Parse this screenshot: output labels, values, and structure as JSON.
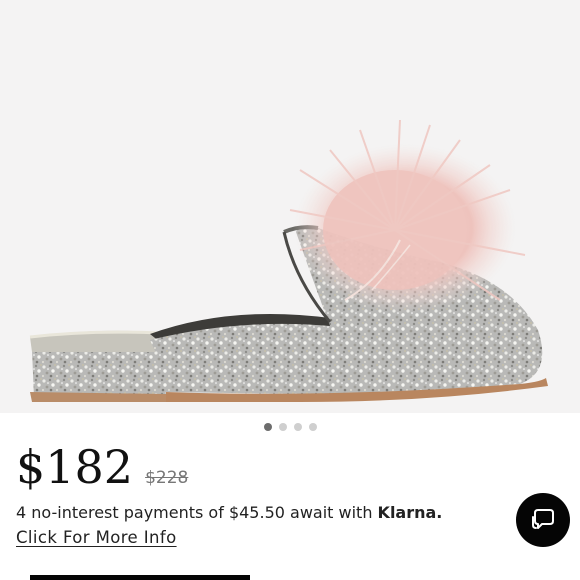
{
  "product": {
    "image_icon": "glitter-feather-mule-image",
    "carousel": {
      "count": 4,
      "active_index": 0
    }
  },
  "pricing": {
    "price": "$182",
    "original_price": "$228"
  },
  "klarna": {
    "text": "4 no-interest payments of $45.50 await with ",
    "brand": "Klarna."
  },
  "info_link": "Click For More Info",
  "chat": {
    "icon": "chat-bubbles-icon"
  },
  "colors": {
    "hero_background": "#f4f3f3",
    "chat_button": "#050505",
    "dot_active": "#6d6d6d",
    "dot_inactive": "#cfcfcf"
  }
}
